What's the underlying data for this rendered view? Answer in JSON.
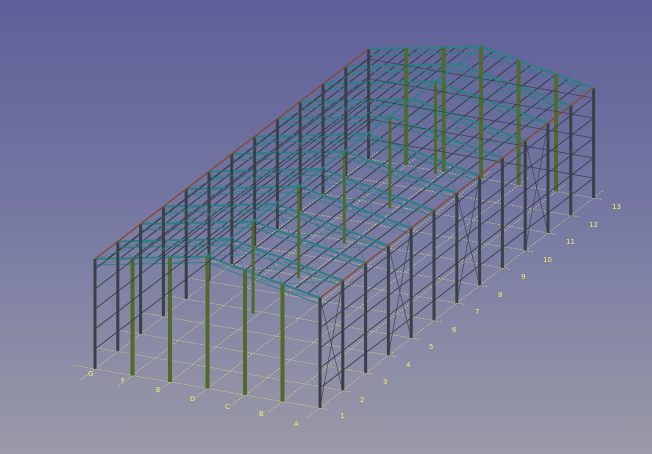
{
  "viewport": {
    "background_top": "#5e5f98",
    "background_bottom": "#9a9aa8",
    "grid_line_color": "#e8e47a",
    "column_color": "#4f6a2c",
    "beam_color": "#2e7f86",
    "purlin_color": "#3a3f48",
    "ridge_color": "#8a4a2e"
  },
  "grid_labels": {
    "letters": [
      "A",
      "B",
      "C",
      "D",
      "E",
      "F",
      "G"
    ],
    "numbers": [
      "1",
      "2",
      "3",
      "4",
      "5",
      "6",
      "7",
      "8",
      "9",
      "10",
      "11",
      "12",
      "13"
    ]
  }
}
